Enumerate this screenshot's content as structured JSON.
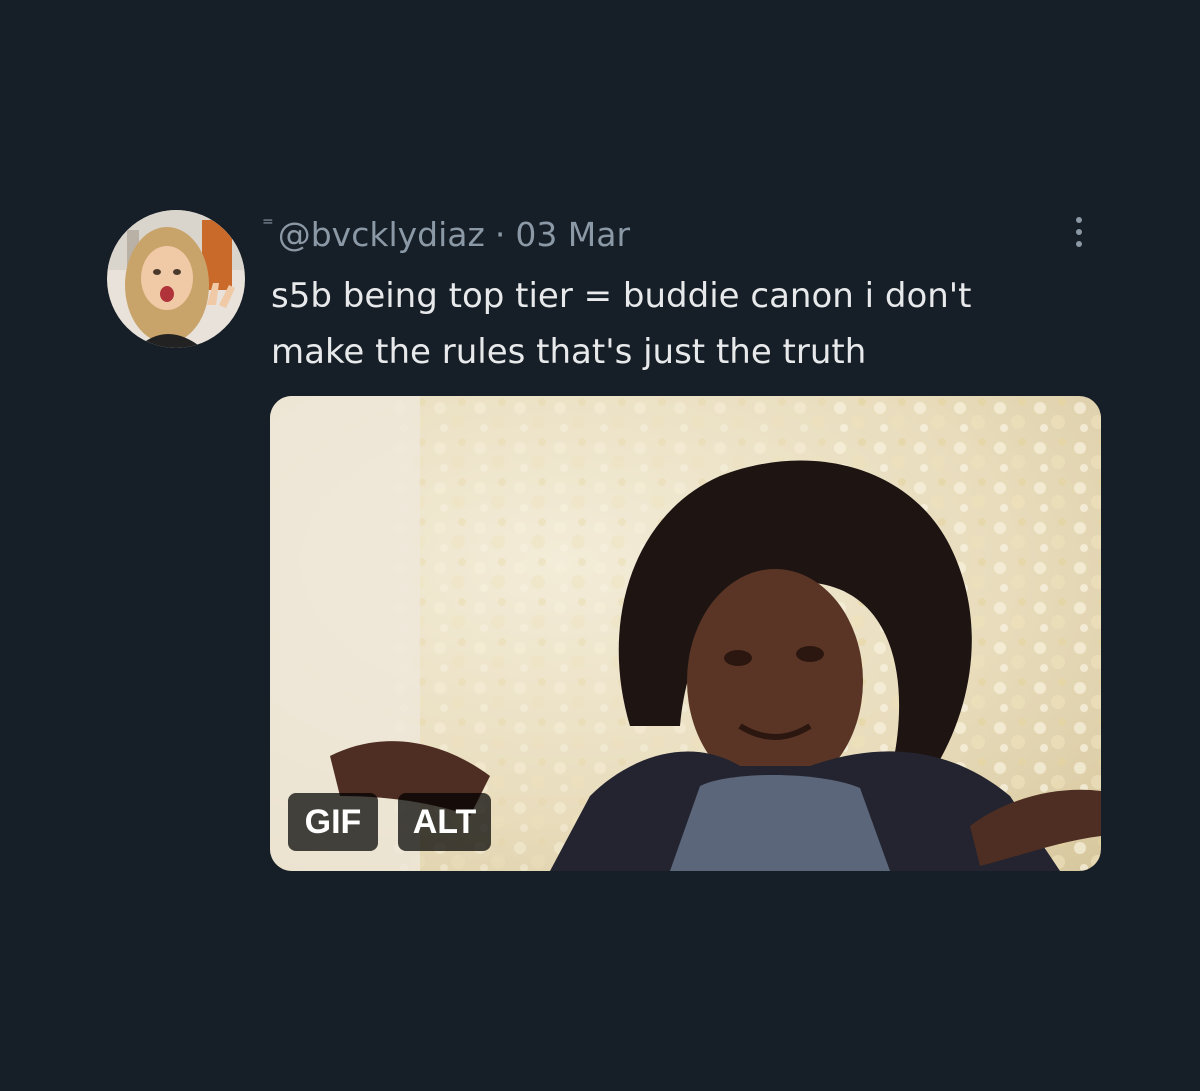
{
  "tweet": {
    "handle": "@bvcklydiaz",
    "separator": "·",
    "date": "03 Mar",
    "text_line1": "s5b being top tier = buddie canon i don't",
    "text_line2": "make the rules that's just the truth",
    "more_icon": "more-vertical-icon"
  },
  "media": {
    "type": "gif",
    "gif_badge": "GIF",
    "alt_badge": "ALT"
  },
  "colors": {
    "background": "#161e27",
    "text_primary": "#e7e9ea",
    "text_secondary": "#8b98a5"
  }
}
